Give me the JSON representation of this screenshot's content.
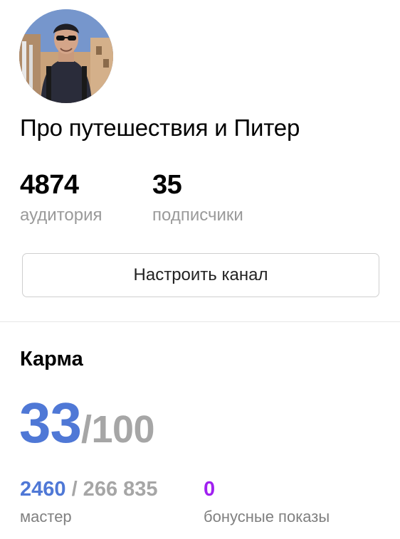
{
  "channel": {
    "title": "Про путешествия и Питер",
    "avatar_icon": "user-avatar-photo"
  },
  "stats": [
    {
      "value": "4874",
      "label": "аудитория"
    },
    {
      "value": "35",
      "label": "подписчики"
    }
  ],
  "settings_button": {
    "label": "Настроить канал"
  },
  "karma": {
    "heading": "Карма",
    "value": "33",
    "max": "/100",
    "master": {
      "current": "2460",
      "rest": " / 266 835",
      "label": "мастер"
    },
    "bonus": {
      "value": "0",
      "label": "бонусные показы"
    }
  },
  "colors": {
    "accent_blue": "#4f78d6",
    "muted_gray": "#a6a6a6",
    "bonus_purple": "#a020f0"
  }
}
